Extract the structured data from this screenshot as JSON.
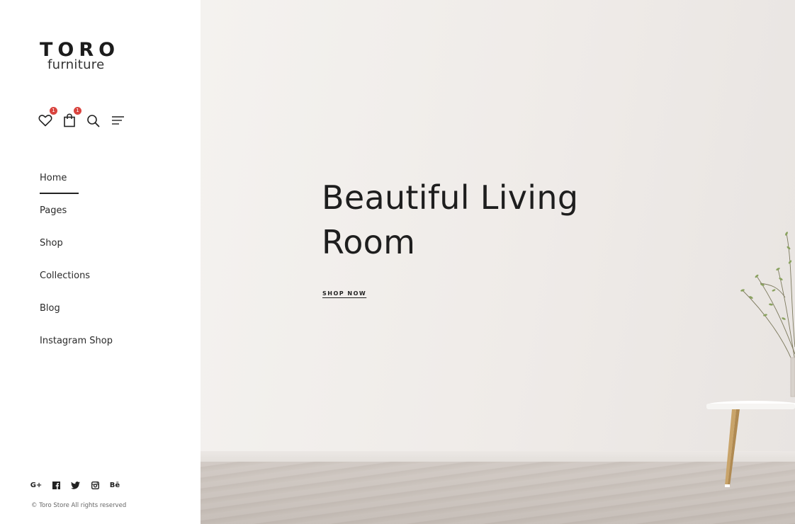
{
  "brand": {
    "name": "TORO",
    "tagline": "furniture"
  },
  "header_icons": [
    {
      "name": "wishlist",
      "icon": "heart-icon",
      "badge": "1"
    },
    {
      "name": "cart",
      "icon": "shopping-bag-icon",
      "badge": "1"
    },
    {
      "name": "search",
      "icon": "search-icon"
    },
    {
      "name": "menu",
      "icon": "menu-icon"
    }
  ],
  "nav": {
    "active": "Home",
    "items": [
      {
        "label": "Home"
      },
      {
        "label": "Pages"
      },
      {
        "label": "Shop"
      },
      {
        "label": "Collections"
      },
      {
        "label": "Blog"
      },
      {
        "label": "Instagram Shop"
      }
    ]
  },
  "social": {
    "google_plus": "G+",
    "facebook": "f",
    "twitter": "twitter",
    "instagram": "instagram",
    "behance": "Bē"
  },
  "footer": {
    "copyright": "© Toro Store All rights reserved"
  },
  "hero": {
    "title_line1": "Beautiful Living",
    "title_line2": "Room",
    "cta": "SHOP NOW"
  },
  "colors": {
    "badge": "#d9443f",
    "text": "#222222",
    "hero_bg": "#f1eeeb"
  }
}
